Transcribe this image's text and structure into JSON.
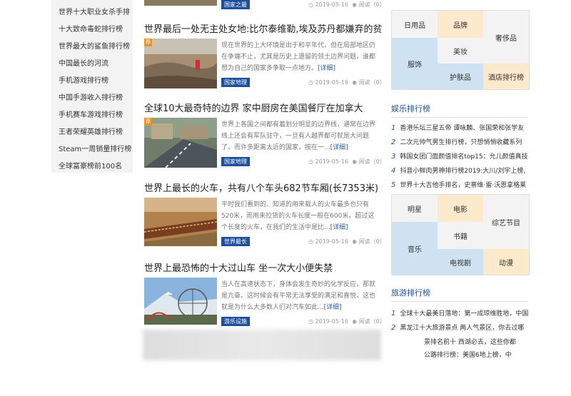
{
  "left_nav": {
    "items": [
      "世界十大职业女杀手排",
      "十大致命毒蛇排行榜",
      "世界最大的鲨鱼排行榜",
      "中国最长的河流",
      "手机游戏排行榜",
      "中国手游收入排行榜",
      "手机赛车游戏排行榜",
      "王者荣耀英雄排行榜",
      "Steam一周销量排行榜",
      "全球富豪榜前100名"
    ]
  },
  "top_partial": {
    "tag": "国家之最",
    "date": "2019-05-16",
    "views": "阅读（0）"
  },
  "articles": [
    {
      "title": "世界最后一处无主处女地:比尔泰维勒,埃及苏丹都嫌弃的贫",
      "flag": "荐",
      "excerpt": "现在世界的上大环境是出于和平年代，但在局部地区仍在争端不止，尤其是历史上遗留的领土边界问题，谁都想为自己的国家多争取一点地方。",
      "more": "[详细]",
      "tag": "国家地理",
      "date": "2019-05-16",
      "views": "阅读（0）"
    },
    {
      "title": "全球10大最奇特的边界 家中厨房在美国餐厅在加拿大",
      "flag": "荐",
      "excerpt": "世界上各国之间都有着划分明显的边界线，通常在边界线上还会有军队驻守，一旦有人越界都可就是大问题了。而许多距离太近的国家，按在一...",
      "more": "[详细]",
      "tag": "国家地理",
      "date": "2019-05-16",
      "views": "阅读（0）"
    },
    {
      "title": "世界上最长的火车，共有八个车头682节车厢(长7353米)",
      "flag": "",
      "excerpt": "平时我们看到的、知道的用来载人的火车最多也只有520米，而用来拉货的火车长度一般在600米。超过这个长度的火车，在我们的生活中是比...",
      "more": "[详细]",
      "tag": "世界最长",
      "date": "2019-05-16",
      "views": "阅读（0）"
    },
    {
      "title": "世界上最恐怖的十大过山车 坐一次大小便失禁",
      "flag": "",
      "excerpt": "当人在高速状态下，身体会发生奇妙的化学反应，那就是亢奋。这时候会有平常无法享受的满足和喜悦，这也就是为什么大多数人们对汽车如此...",
      "more": "[详细]",
      "tag": "游乐设施",
      "date": "2019-05-16",
      "views": "阅读（0）"
    }
  ],
  "category_grid_1": [
    "日用品",
    "品牌",
    "奢侈品",
    "服饰",
    "美妆",
    "护肤品",
    "酒店排行榜"
  ],
  "ent_section": {
    "title": "娱乐排行榜",
    "items": [
      {
        "n": "1",
        "text": "香港乐坛三星五帝 谭咏麟、张国荣和张学友"
      },
      {
        "n": "2",
        "text": "二次元帅气男生排行榜，只想悄悄收藏系列"
      },
      {
        "n": "3",
        "text": "韩国女团门面颜值排名top15：允儿颜值真技"
      },
      {
        "n": "4",
        "text": "抖音小鲜肉男神排行榜2019:大川/刘宇上榜,"
      },
      {
        "n": "5",
        "text": "世界十大吉他手排名，史蒂维·雷·沃恩拿格莱"
      }
    ]
  },
  "category_grid_2": [
    "明星",
    "电影",
    "综艺节目",
    "音乐",
    "书籍",
    "电视剧",
    "动漫"
  ],
  "travel_section": {
    "title": "旅游排行榜",
    "items": [
      {
        "n": "1",
        "text": "全球十大最美日落地：第一成琼维胜地，中国"
      },
      {
        "n": "2",
        "text": "黑龙江十大旅游景点 两人气景区，你去过哪"
      },
      {
        "n": "",
        "text": "景排名前十 西湖必去，这些你都"
      },
      {
        "n": "",
        "text": "公路排行榜：美国6地上榜，中"
      }
    ]
  }
}
